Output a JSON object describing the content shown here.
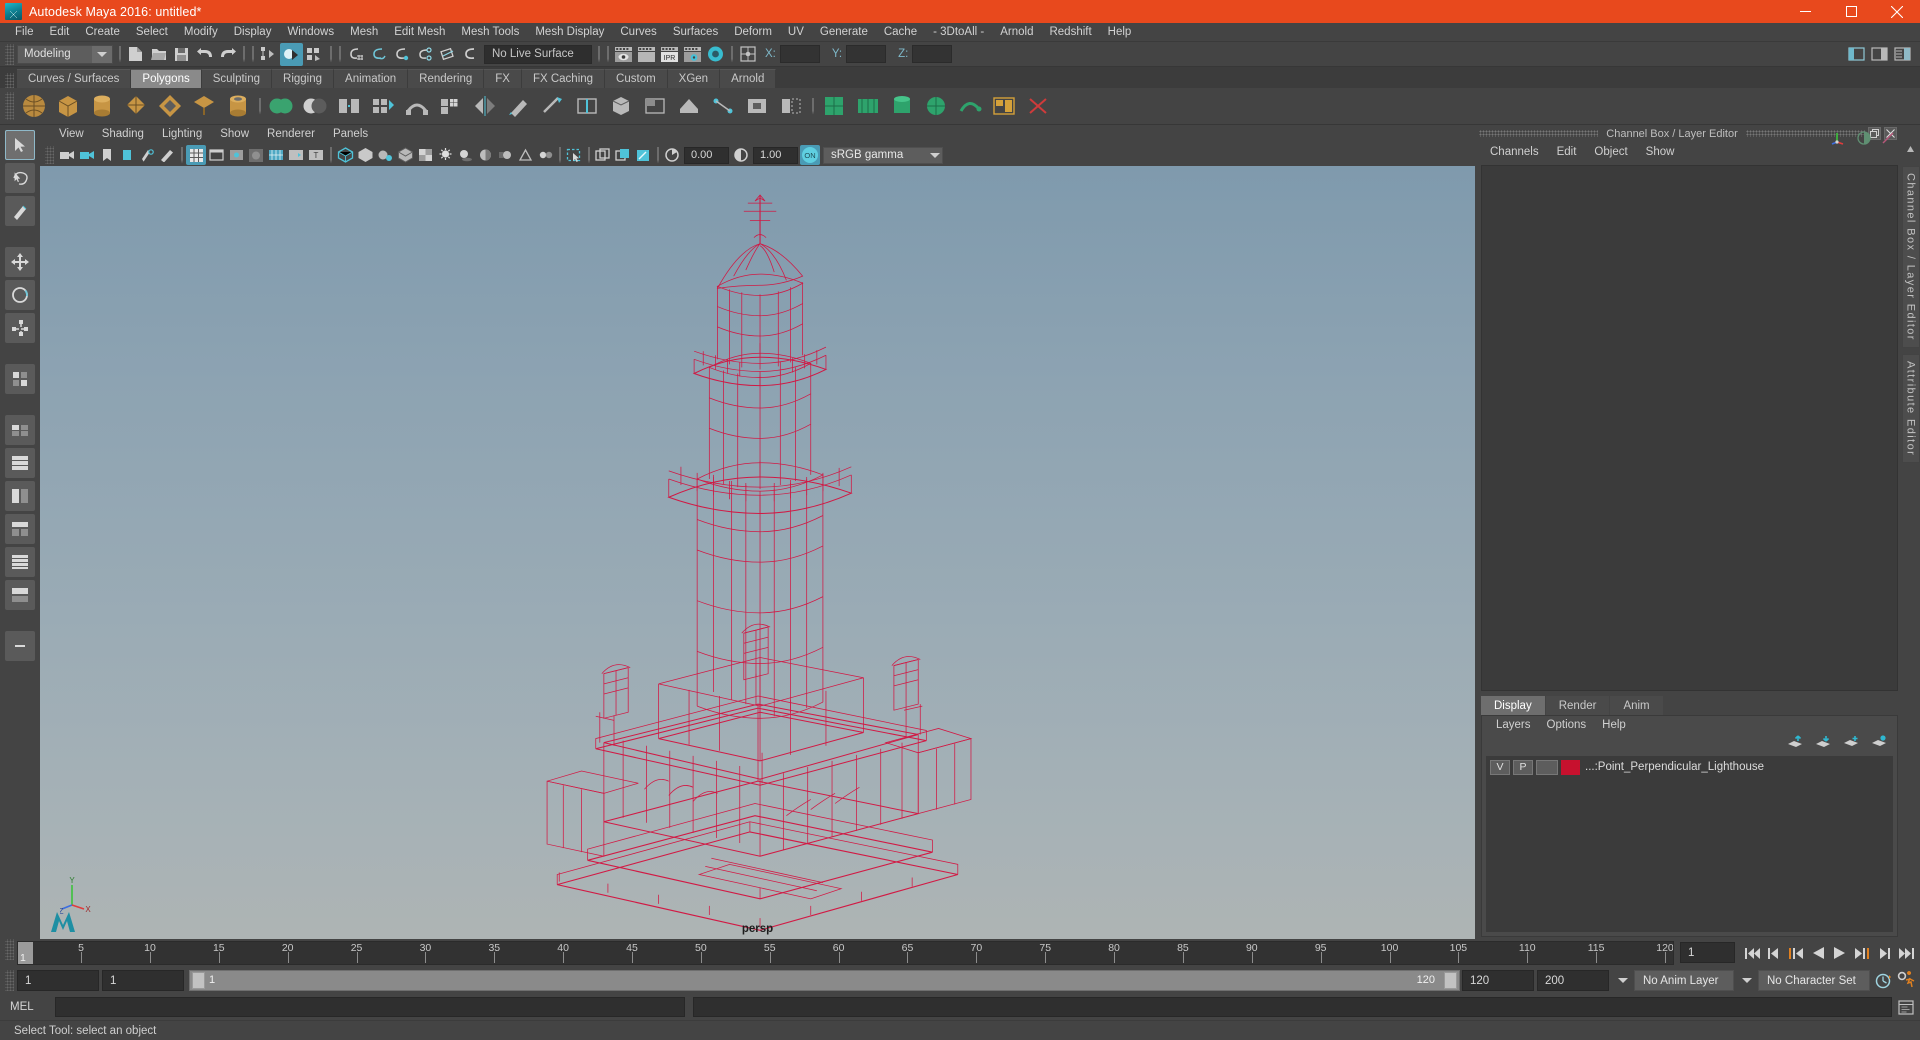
{
  "window": {
    "title": "Autodesk Maya 2016: untitled*",
    "app_icon": "maya-logo-icon",
    "minimize": "minimize-icon",
    "maximize": "maximize-icon",
    "close": "close-icon",
    "titlebar_color": "#e8491d"
  },
  "menubar": {
    "items": [
      "File",
      "Edit",
      "Create",
      "Select",
      "Modify",
      "Display",
      "Windows",
      "Mesh",
      "Edit Mesh",
      "Mesh Tools",
      "Mesh Display",
      "Curves",
      "Surfaces",
      "Deform",
      "UV",
      "Generate",
      "Cache",
      "- 3DtoAll -",
      "Arnold",
      "Redshift",
      "Help"
    ]
  },
  "statusline": {
    "mode": "Modeling",
    "live_surface": "No Live Surface",
    "coord_x_label": "X:",
    "coord_y_label": "Y:",
    "coord_z_label": "Z:",
    "coord_x_value": "",
    "coord_y_value": "",
    "coord_z_value": "",
    "ipr_label": "IPR"
  },
  "shelf": {
    "tabs": [
      "Curves / Surfaces",
      "Polygons",
      "Sculpting",
      "Rigging",
      "Animation",
      "Rendering",
      "FX",
      "FX Caching",
      "Custom",
      "XGen",
      "Arnold"
    ],
    "selected_tab": "Polygons"
  },
  "viewport_panel": {
    "menus": [
      "View",
      "Shading",
      "Lighting",
      "Show",
      "Renderer",
      "Panels"
    ],
    "exposure_value": "0.00",
    "gamma_value": "1.00",
    "color_management": "sRGB gamma",
    "color_mgmt_toggle": "ON",
    "camera_label": "persp",
    "axis_gizmo": {
      "y": "Y",
      "x": "X",
      "z": "Z"
    }
  },
  "right_dock": {
    "panel_title": "Channel Box / Layer Editor",
    "channelbox_menus": [
      "Channels",
      "Edit",
      "Object",
      "Show"
    ],
    "vertical_tabs": [
      "Channel Box / Layer Editor",
      "Attribute Editor"
    ],
    "layer_editor": {
      "tabs": [
        "Display",
        "Render",
        "Anim"
      ],
      "selected_tab": "Display",
      "menus": [
        "Layers",
        "Options",
        "Help"
      ],
      "layers": [
        {
          "visibility": "V",
          "playback": "P",
          "third": "",
          "color": "#c7112e",
          "name": "...:Point_Perpendicular_Lighthouse"
        }
      ]
    }
  },
  "timeline": {
    "tick_labels": [
      "5",
      "10",
      "15",
      "20",
      "25",
      "30",
      "35",
      "40",
      "45",
      "50",
      "55",
      "60",
      "65",
      "70",
      "75",
      "80",
      "85",
      "90",
      "95",
      "100",
      "105",
      "110",
      "115",
      "120"
    ],
    "tick_values": [
      5,
      10,
      15,
      20,
      25,
      30,
      35,
      40,
      45,
      50,
      55,
      60,
      65,
      70,
      75,
      80,
      85,
      90,
      95,
      100,
      105,
      110,
      115,
      120
    ],
    "range_start": 1,
    "range_end": 120,
    "current_frame": "1",
    "current_frame_field": "1",
    "playback_start": "1",
    "anim_start": "1",
    "playback_end": "120",
    "anim_end": "200",
    "range_slider_label": "1",
    "range_slider_end_label": "120",
    "anim_layer": "No Anim Layer",
    "character_set": "No Character Set"
  },
  "command_line": {
    "label": "MEL",
    "input_value": "",
    "output_value": ""
  },
  "status_bar": {
    "message": "Select Tool: select an object"
  },
  "toolbox": {
    "items": [
      "select-tool",
      "lasso-select-tool",
      "paint-select-tool",
      "move-tool",
      "rotate-tool",
      "scale-tool",
      "last-tool-used",
      "show-manipulator-tool",
      "single-perspective-layout",
      "four-view-layout",
      "persp-outliner-layout",
      "hypergraph-layout",
      "persp-graph-layout",
      "two-pane-stacked-layout",
      "more-layouts"
    ]
  }
}
